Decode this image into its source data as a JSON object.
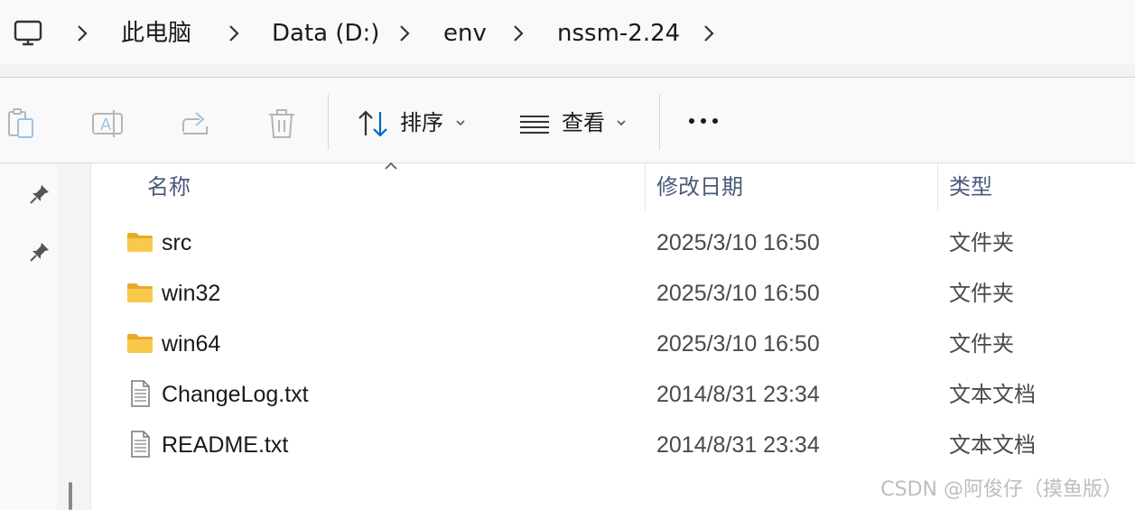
{
  "breadcrumb": {
    "root_icon": "monitor-icon",
    "items": [
      "此电脑",
      "Data (D:)",
      "env",
      "nssm-2.24"
    ]
  },
  "toolbar": {
    "copy_icon": "clipboard-icon",
    "rename_icon": "rename-icon",
    "share_icon": "share-icon",
    "delete_icon": "trash-icon",
    "sort_label": "排序",
    "view_label": "查看",
    "more_icon": "more-icon"
  },
  "columns": {
    "name": "名称",
    "modified": "修改日期",
    "type": "类型"
  },
  "files": [
    {
      "name": "src",
      "modified": "2025/3/10 16:50",
      "type": "文件夹",
      "icon": "folder-icon"
    },
    {
      "name": "win32",
      "modified": "2025/3/10 16:50",
      "type": "文件夹",
      "icon": "folder-icon"
    },
    {
      "name": "win64",
      "modified": "2025/3/10 16:50",
      "type": "文件夹",
      "icon": "folder-icon"
    },
    {
      "name": "ChangeLog.txt",
      "modified": "2014/8/31 23:34",
      "type": "文本文档",
      "icon": "text-file-icon"
    },
    {
      "name": "README.txt",
      "modified": "2014/8/31 23:34",
      "type": "文本文档",
      "icon": "text-file-icon"
    }
  ],
  "watermark": "CSDN @阿俊仔（摸鱼版）",
  "colors": {
    "folder": "#f8c94a",
    "accent": "#0067c0",
    "header_text": "#4a5a7a"
  }
}
